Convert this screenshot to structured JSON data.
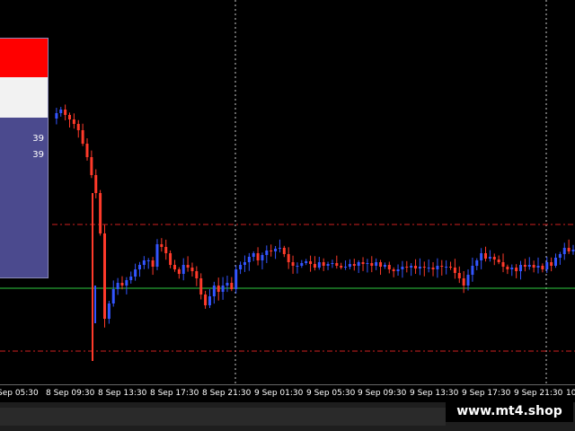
{
  "chart": {
    "colors": {
      "background": "#000000",
      "bull_candle": "#3355ff",
      "bear_candle": "#ff3a2a",
      "grid": "#ffffff",
      "level_line": "#d02020",
      "ma_line": "#2ecc40"
    },
    "chart_data": {
      "type": "candlestick",
      "x_tick_labels": [
        "Sep 05:30",
        "8 Sep 09:30",
        "8 Sep 13:30",
        "8 Sep 17:30",
        "8 Sep 21:30",
        "9 Sep 01:30",
        "9 Sep 05:30",
        "9 Sep 09:30",
        "9 Sep 13:30",
        "9 Sep 17:30",
        "9 Sep 21:30",
        "10"
      ],
      "close_series": [
        132,
        126,
        122,
        128,
        133,
        138,
        145,
        160,
        175,
        195,
        215,
        260,
        355,
        338,
        322,
        315,
        318,
        312,
        308,
        300,
        295,
        290,
        290,
        297,
        272,
        275,
        282,
        295,
        300,
        305,
        295,
        298,
        302,
        310,
        328,
        340,
        330,
        318,
        325,
        318,
        315,
        322,
        300,
        295,
        292,
        286,
        282,
        290,
        284,
        279,
        280,
        277,
        276,
        283,
        292,
        296,
        296,
        293,
        291,
        294,
        298,
        292,
        296,
        294,
        293,
        296,
        298,
        297,
        294,
        296,
        292,
        294,
        293,
        296,
        292,
        297,
        295,
        300,
        302,
        300,
        297,
        298,
        296,
        299,
        297,
        298,
        298,
        300,
        296,
        297,
        297,
        298,
        304,
        310,
        318,
        306,
        296,
        290,
        282,
        288,
        286,
        289,
        292,
        297,
        300,
        298,
        302,
        295,
        297,
        295,
        298,
        296,
        300,
        292,
        296,
        287,
        283,
        276,
        280,
        278
      ],
      "level_lines": [
        "upper_resistance",
        "lower_support"
      ],
      "moving_average": "flat"
    }
  },
  "info_panel": {
    "line1": "39",
    "line2": "39"
  },
  "watermark": {
    "text": "www.mt4.shop"
  }
}
